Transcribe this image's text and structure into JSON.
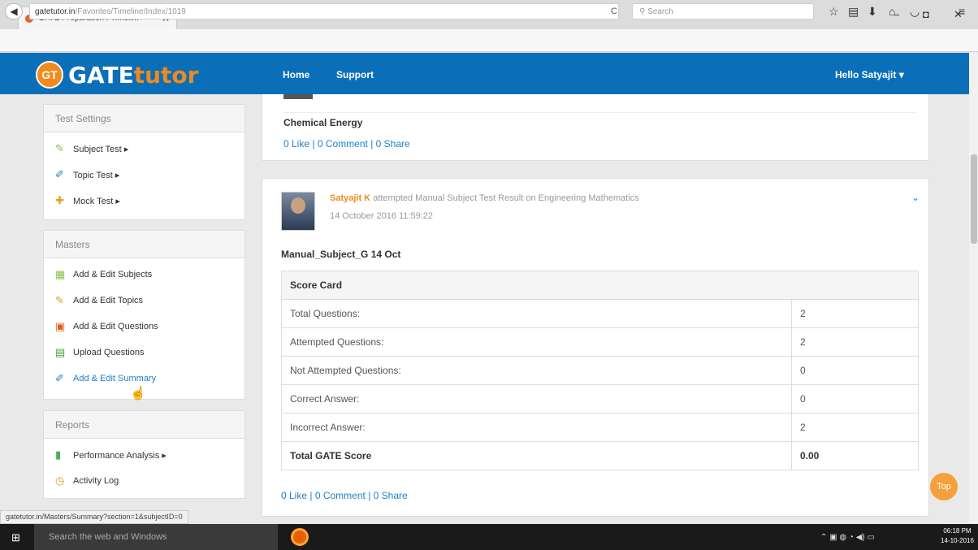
{
  "browser": {
    "tab_title": "GATE Preparation : Timeli...",
    "tab_close": "✕",
    "new_tab": "+",
    "url_domain": "gatetutor.in",
    "url_path": "/Favorites/Timeline/Index/1019",
    "search_placeholder": "Search",
    "min": "‒",
    "max": "◘",
    "close": "✕"
  },
  "site": {
    "logo_badge": "GT",
    "logo_part1": "GATE",
    "logo_part2": "tutor",
    "nav_home": "Home",
    "nav_support": "Support",
    "greeting": "Hello Satyajit ▾"
  },
  "sidebar": {
    "test_settings": {
      "title": "Test Settings",
      "items": [
        "Subject Test ▸",
        "Topic Test ▸",
        "Mock Test ▸"
      ]
    },
    "masters": {
      "title": "Masters",
      "items": [
        "Add & Edit Subjects",
        "Add & Edit Topics",
        "Add & Edit Questions",
        "Upload Questions",
        "Add & Edit Summary"
      ]
    },
    "reports": {
      "title": "Reports",
      "items": [
        "Performance Analysis ▸",
        "Activity Log"
      ]
    }
  },
  "post1": {
    "title": "Chemical Energy",
    "like": "0 Like",
    "comment": "0 Comment",
    "share": "0 Share"
  },
  "post2": {
    "author": "Satyajit K",
    "action": "attempted Manual Subject Test Result on Engineering Mathematics",
    "timestamp": "14 October 2016 11:59:22",
    "test_name": "Manual_Subject_G 14 Oct",
    "scorecard_title": "Score Card",
    "rows": [
      {
        "label": "Total Questions:",
        "value": "2"
      },
      {
        "label": "Attempted Questions:",
        "value": "2"
      },
      {
        "label": "Not Attempted Questions:",
        "value": "0"
      },
      {
        "label": "Correct Answer:",
        "value": "0"
      },
      {
        "label": "Incorrect Answer:",
        "value": "2"
      }
    ],
    "total_label": "Total GATE Score",
    "total_value": "0.00",
    "like": "0 Like",
    "comment": "0 Comment",
    "share": "0 Share"
  },
  "top_button": "Top",
  "status_url": "gatetutor.in/Masters/Summary?section=1&subjectID=0",
  "taskbar": {
    "search_placeholder": "Search the web and Windows",
    "time": "06:18 PM",
    "date": "14-10-2016"
  }
}
